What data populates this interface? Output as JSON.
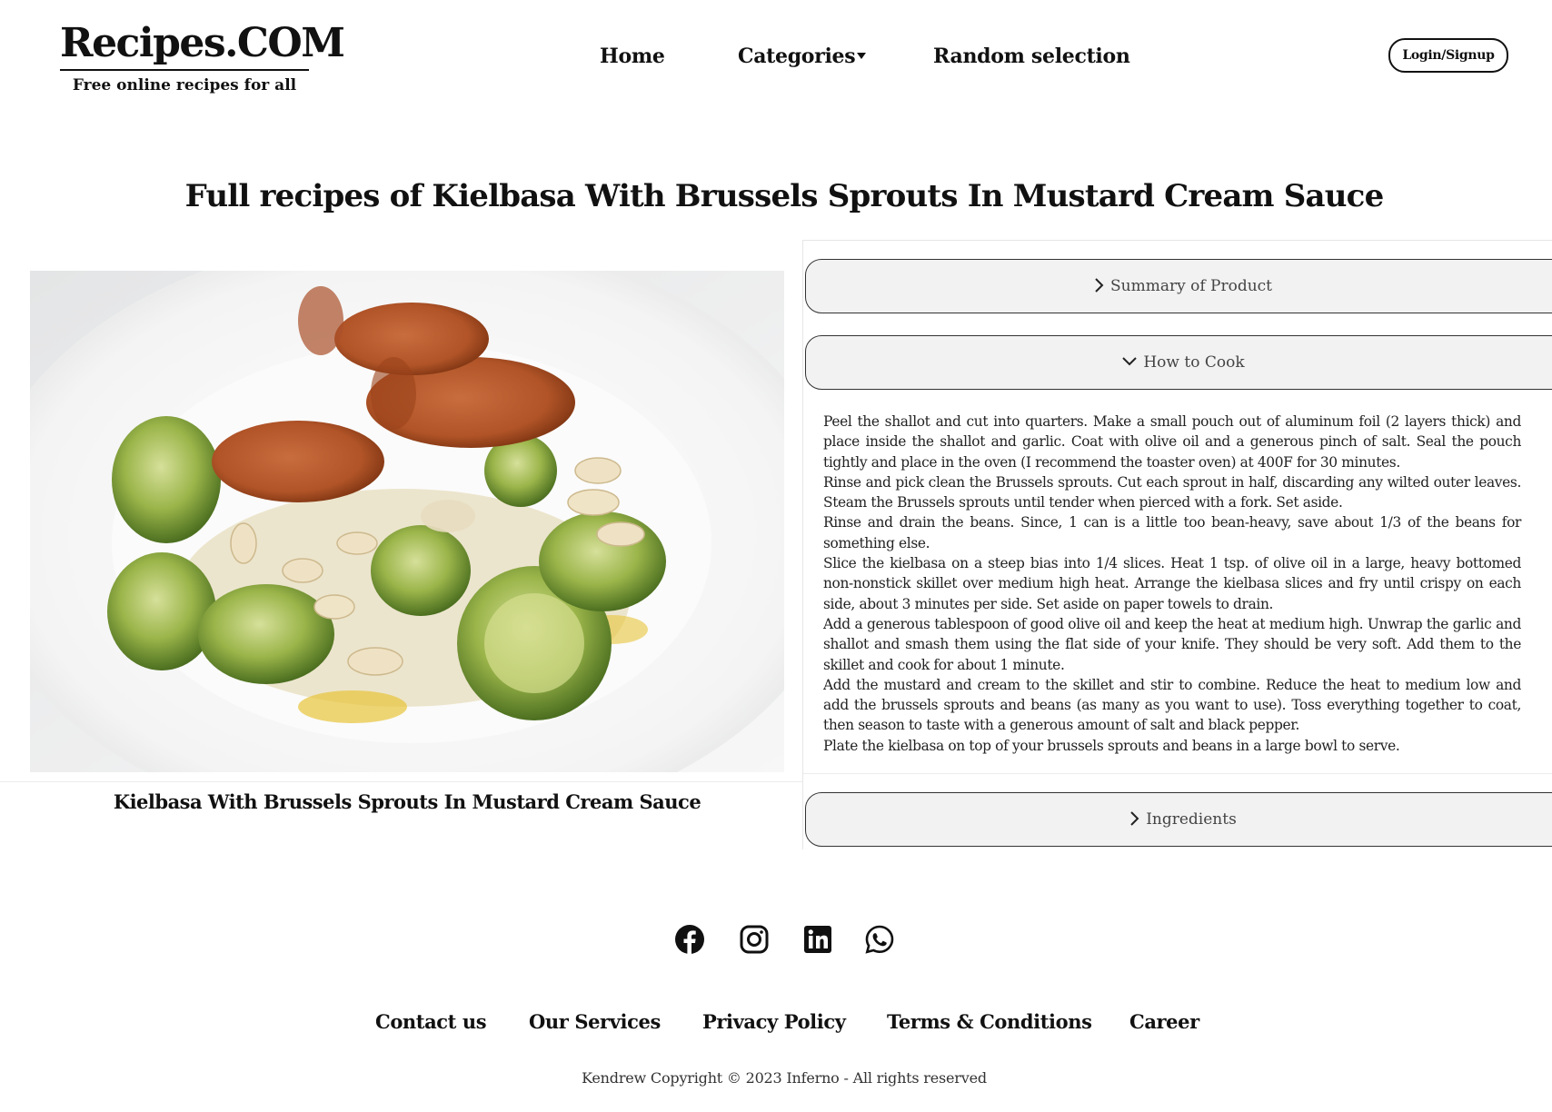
{
  "header": {
    "brand_name": "Recipes.COM",
    "tagline": "Free online recipes for all",
    "nav": {
      "home": "Home",
      "categories": "Categories",
      "random": "Random selection"
    },
    "login_label": "Login/Signup"
  },
  "page": {
    "title": "Full recipes of Kielbasa With Brussels Sprouts In Mustard Cream Sauce",
    "image_caption": "Kielbasa With Brussels Sprouts In Mustard Cream Sauce"
  },
  "accordion": {
    "summary_label": "Summary of Product",
    "howto_label": "How to Cook",
    "ingredients_label": "Ingredients",
    "howto_expanded": true,
    "howto_steps": [
      "Peel the shallot and cut into quarters. Make a small pouch out of aluminum foil (2 layers thick) and place inside the shallot and garlic. Coat with olive oil and a generous pinch of salt. Seal the pouch tightly and place in the oven (I recommend the toaster oven) at 400F for 30 minutes.",
      "Rinse and pick clean the Brussels sprouts. Cut each sprout in half, discarding any wilted outer leaves. Steam the Brussels sprouts until tender when pierced with a fork. Set aside.",
      "Rinse and drain the beans. Since, 1 can is a little too bean-heavy, save about 1/3 of the beans for something else.",
      "Slice the kielbasa on a steep bias into 1/4 slices. Heat 1 tsp. of olive oil in a large, heavy bottomed non-nonstick skillet over medium high heat. Arrange the kielbasa slices and fry until crispy on each side, about 3 minutes per side. Set aside on paper towels to drain.",
      "Add a generous tablespoon of good olive oil and keep the heat at medium high. Unwrap the garlic and shallot and smash them using the flat side of your knife. They should be very soft. Add them to the skillet and cook for about 1 minute.",
      "Add the mustard and cream to the skillet and stir to combine. Reduce the heat to medium low and add the brussels sprouts and beans (as many as you want to use). Toss everything together to coat, then season to taste with a generous amount of salt and black pepper.",
      "Plate the kielbasa on top of your brussels sprouts and beans in a large bowl to serve."
    ]
  },
  "footer": {
    "social": [
      "facebook-icon",
      "instagram-icon",
      "linkedin-icon",
      "whatsapp-icon"
    ],
    "links": {
      "contact": "Contact us",
      "services": "Our Services",
      "privacy": "Privacy Policy",
      "terms": "Terms & Conditions",
      "career": "Career"
    },
    "copyright": "Kendrew Copyright © 2023 Inferno - All rights reserved"
  },
  "colors": {
    "text": "#111111",
    "accordion_bg": "#f2f2f2",
    "accordion_border": "#333333",
    "body_text": "#222222"
  }
}
